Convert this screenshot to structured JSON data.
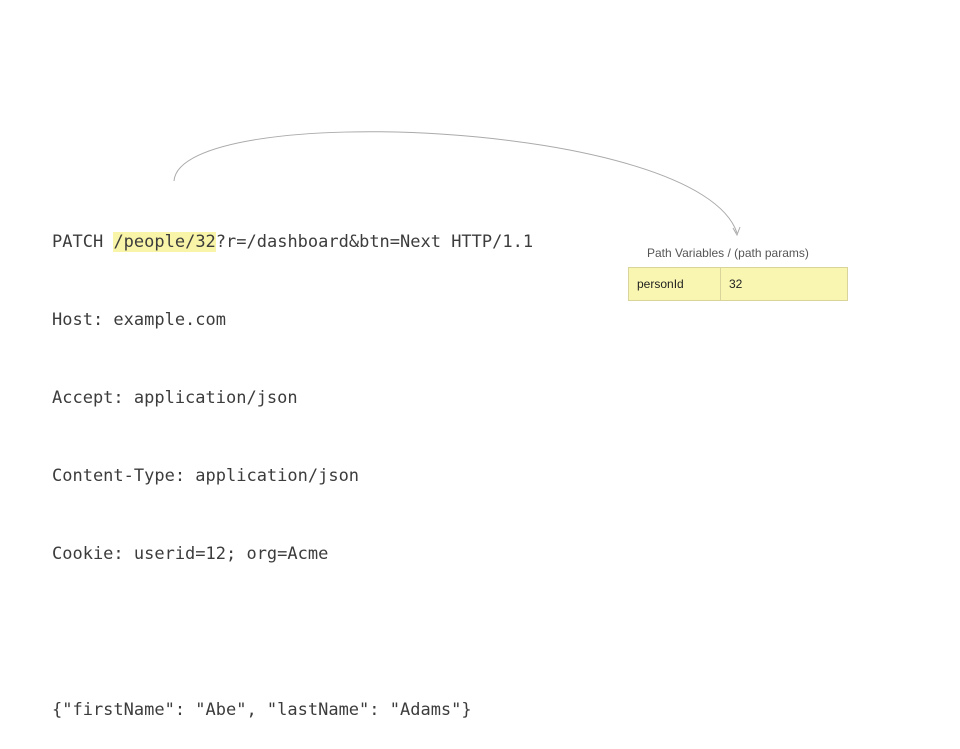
{
  "request": {
    "method": "PATCH",
    "path": "/people/32",
    "query_and_version": "?r=/dashboard&btn=Next HTTP/1.1",
    "headers": [
      "Host: example.com",
      "Accept: application/json",
      "Content-Type: application/json",
      "Cookie: userid=12; org=Acme"
    ],
    "body": "{\"firstName\": \"Abe\", \"lastName\": \"Adams\"}"
  },
  "path_variables": {
    "caption": "Path Variables / (path params)",
    "rows": [
      {
        "name": "personId",
        "value": "32"
      }
    ]
  },
  "colors": {
    "highlight": "#f8f5a8",
    "text": "#3c3c3c",
    "connector": "#aaaaaa"
  }
}
